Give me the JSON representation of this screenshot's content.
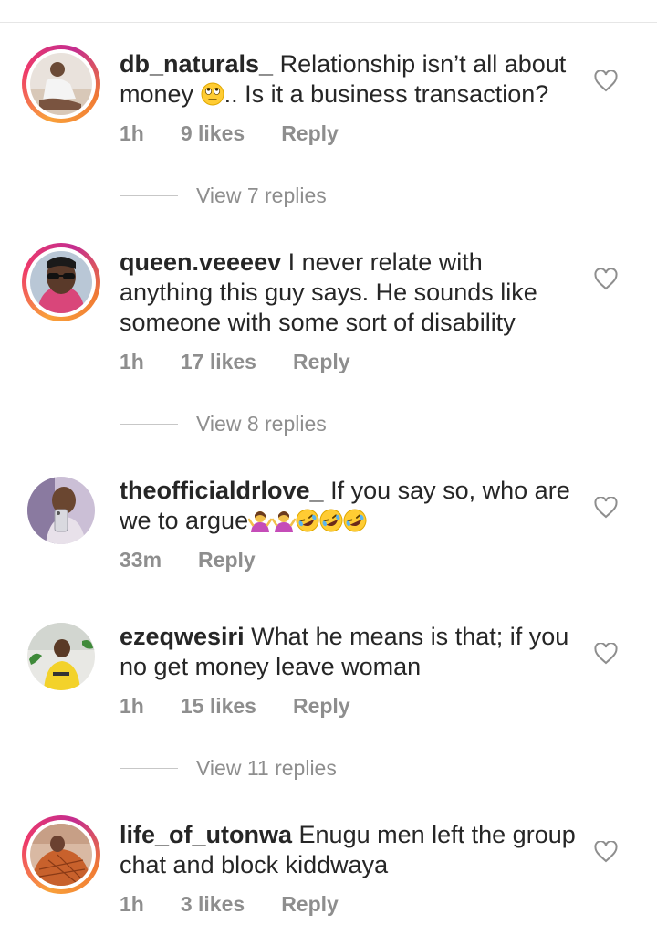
{
  "comments": [
    {
      "username": "db_naturals_",
      "text": "Relationship isn’t all about money",
      "text_suffix": ".. Is it a business transaction?",
      "time": "1h",
      "likes": "9 likes",
      "reply": "Reply",
      "view_replies": "View 7 replies",
      "avatar_icon": "avatar-woman-white-outfit"
    },
    {
      "username": "queen.veeeev",
      "text": "I never relate with anything this guy says. He sounds like someone with some sort of disability",
      "time": "1h",
      "likes": "17 likes",
      "reply": "Reply",
      "view_replies": "View 8 replies",
      "avatar_icon": "avatar-woman-sunglasses"
    },
    {
      "username": "theofficialdrlove_",
      "text": "If you say so, who are we to argue",
      "time": "33m",
      "reply": "Reply",
      "avatar_icon": "avatar-woman-phone-selfie"
    },
    {
      "username": "ezeqwesiri",
      "text": "What he means is that; if you no get money leave woman",
      "time": "1h",
      "likes": "15 likes",
      "reply": "Reply",
      "view_replies": "View 11 replies",
      "avatar_icon": "avatar-man-yellow-shirt"
    },
    {
      "username": "life_of_utonwa",
      "text": "Enugu men left the group chat and block kiddwaya",
      "time": "1h",
      "likes": "3 likes",
      "reply": "Reply",
      "avatar_icon": "avatar-woman-orange-outfit"
    }
  ],
  "colors": {
    "text": "#262626",
    "secondary": "#8e8e8e",
    "story_ring_start": "#f9a13a",
    "story_ring_end": "#c42d8f"
  },
  "icons": [
    "heart-outline-icon",
    "rolling-eyes-emoji",
    "shrug-emoji",
    "rofl-emoji"
  ]
}
